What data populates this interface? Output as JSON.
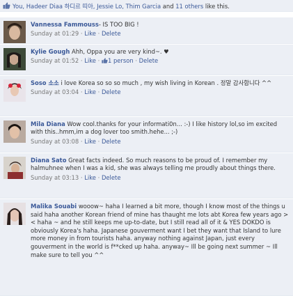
{
  "likes": {
    "names": "You, Hadeer Diaa 하디르 띠아, Jessie Lo, Thim Garcia",
    "and_text": "and",
    "others": "11 others",
    "suffix": "like this."
  },
  "comments": [
    {
      "author": "Vannessa Fammouss",
      "text": "- IS TOO BIG !",
      "timestamp": "Sunday at 01:29",
      "like_label": "Like",
      "delete_label": "Delete"
    },
    {
      "author": "Kylie Gough",
      "text": "Ahh, Oppa you are very kind~. ♥",
      "timestamp": "Sunday at 01:52",
      "like_label": "Like",
      "like_count": "1 person",
      "delete_label": "Delete"
    },
    {
      "author": "Soso 소소",
      "text": "i love Korea so so so much , my wish living in Korean . 정말 감사합니다 ^^",
      "timestamp": "Sunday at 03:04",
      "like_label": "Like",
      "delete_label": "Delete"
    },
    {
      "author": "Mila Diana",
      "text": "Wow cool.thanks for your informati0n... :-) I like history lol,so im excited with this..hmm,im a dog lover too smith.hehe... ;-)",
      "timestamp": "Sunday at 03:08",
      "like_label": "Like",
      "delete_label": "Delete"
    },
    {
      "author": "Diana Sato",
      "text": "Great facts indeed. So much reasons to be proud of. I remember my halmuhnee when I was a kid, she was always telling me proudly about things there.",
      "timestamp": "Sunday at 03:13",
      "like_label": "Like",
      "delete_label": "Delete"
    },
    {
      "author": "Malika Souabi",
      "text": "wooow~ haha I learned a bit more, though I know most of the things u said haha another Korean friend of mine has thaught me lots abt Korea few years ago > < haha ~ and he still keeps me up-to-date, but I still read all of it & YES DOKDO is obviously Korea's haha. Japanese gouverment want I bet they want that Island to lure more money in from tourists haha. anyway nothing against Japan, just every gouverment in the world is f**cked up haha. anyway~ Ill be going next summer ~ Ill make sure to tell you ^^"
    }
  ],
  "separators": {
    "dot": "·"
  }
}
